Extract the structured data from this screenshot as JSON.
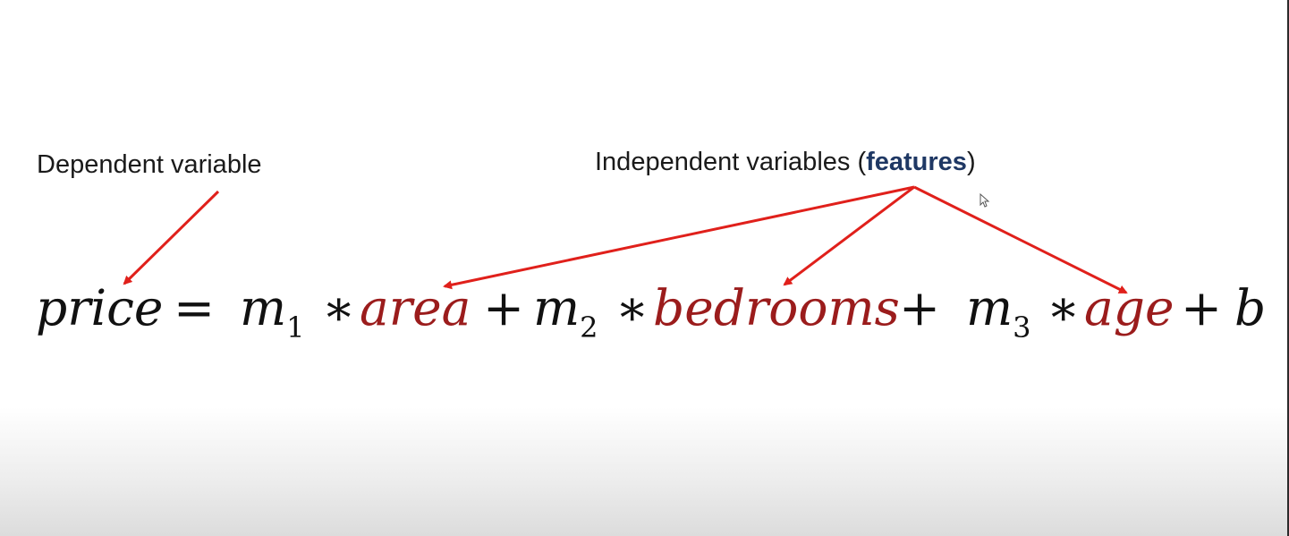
{
  "labels": {
    "dependent": "Dependent variable",
    "independent_prefix": "Independent variables (",
    "independent_emphasis": "features",
    "independent_suffix": ")"
  },
  "equation": {
    "lhs": "price",
    "equals": "=",
    "m": "m",
    "sub1": "1",
    "sub2": "2",
    "sub3": "3",
    "times": "∗",
    "plus": "+",
    "feature1": "area",
    "feature2": "bedrooms",
    "feature3": "age",
    "intercept": "b"
  },
  "colors": {
    "arrow": "#e0201b",
    "feature_text": "#9b1c1c",
    "emphasis": "#1f3864"
  }
}
